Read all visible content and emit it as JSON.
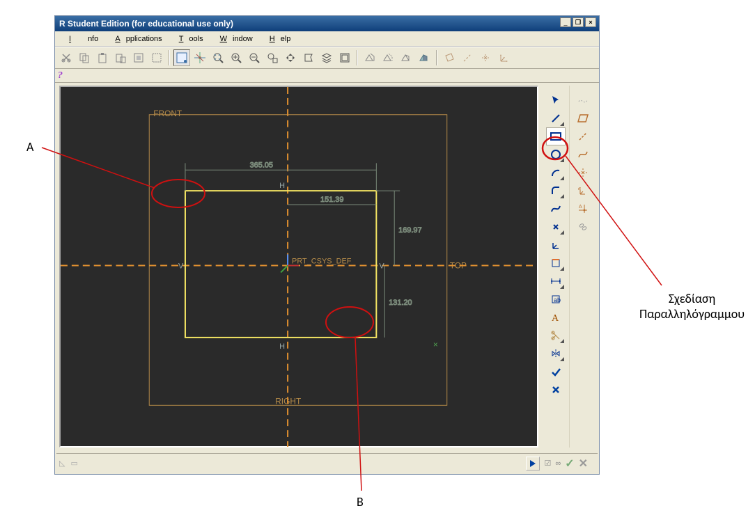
{
  "window": {
    "title": "R Student Edition (for educational use only)"
  },
  "menu": {
    "info": "Info",
    "applications": "Applications",
    "tools": "Tools",
    "window": "Window",
    "help": "Help"
  },
  "help_button": "?",
  "canvas": {
    "datum_labels": {
      "front": "FRONT",
      "right": "RIGHT",
      "top": "TOP"
    },
    "csys_label": "PRT_CSYS_DEF",
    "constraints": {
      "H": "H",
      "V": "V"
    },
    "dims": {
      "width": "365.05",
      "half_width": "151.39",
      "height": "169.97",
      "half_height": "131.20"
    }
  },
  "annotations": {
    "A": "A",
    "B": "B",
    "rect_tool": [
      "Σχεδίαση",
      "Παραλληλόγραμμου"
    ]
  },
  "icons": {
    "select": "select-arrow",
    "line": "line",
    "rect": "rectangle",
    "circle": "circle",
    "arc": "arc",
    "fillet": "fillet",
    "spline": "spline",
    "point": "point",
    "csys": "csys",
    "use_edge": "use-edge",
    "dim": "dimension",
    "mod_dim": "modify-dim",
    "text": "text",
    "mirror": "mirror",
    "trim": "trim",
    "done": "done",
    "abort": "abort",
    "constrain": "constrain",
    "parallelogram": "parallelogram",
    "construction": "construction",
    "offset": "offset",
    "tangent": "tangent",
    "chain": "chain"
  }
}
